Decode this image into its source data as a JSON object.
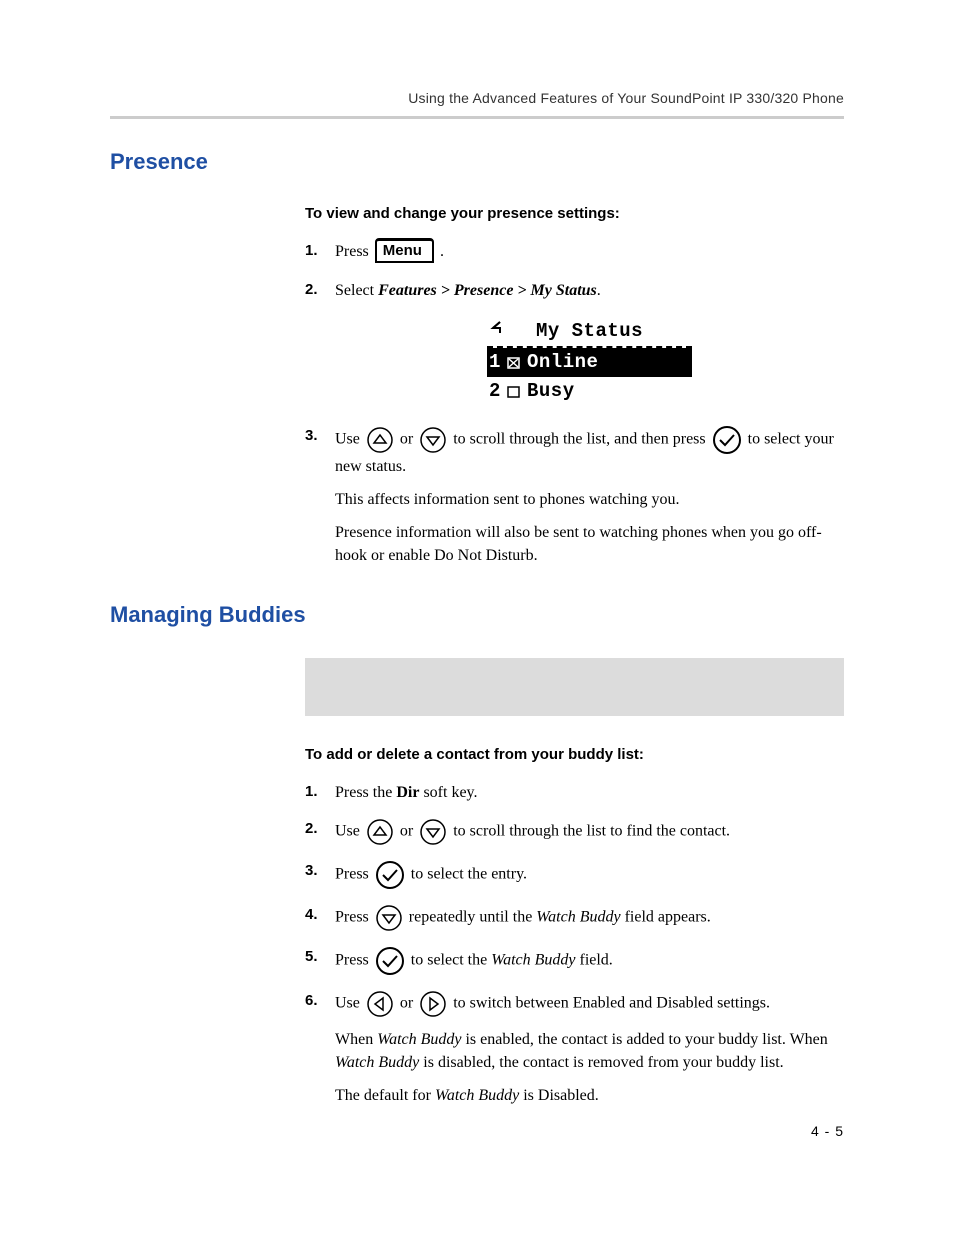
{
  "runningHead": "Using the Advanced Features of Your SoundPoint IP 330/320 Phone",
  "section1": {
    "title": "Presence",
    "lead": "To view and change your presence settings:",
    "steps": {
      "s1a": "Press ",
      "menuLabel": "Menu",
      "s1b": " .",
      "s2a": "Select ",
      "s2path": "Features > Presence > My Status",
      "s2b": ".",
      "lcd": {
        "title": "My Status",
        "r1num": "1",
        "r1label": "Online",
        "r2num": "2",
        "r2label": "Busy"
      },
      "s3a": "Use ",
      "s3b": " or ",
      "s3c": " to scroll through the list, and then press ",
      "s3d": " to select your new status.",
      "s3p2": "This affects information sent to phones watching you.",
      "s3p3": "Presence information will also be sent to watching phones when you go off-hook or enable Do Not Disturb."
    }
  },
  "section2": {
    "title": "Managing Buddies",
    "lead": "To add or delete a contact from your buddy list:",
    "steps": {
      "s1a": "Press the ",
      "s1dir": "Dir",
      "s1b": " soft key.",
      "s2a": "Use ",
      "s2b": " or ",
      "s2c": " to scroll through the list to find the contact.",
      "s3a": "Press ",
      "s3b": " to select the entry.",
      "s4a": "Press ",
      "s4b": " repeatedly until the ",
      "s4wb": "Watch Buddy",
      "s4c": " field appears.",
      "s5a": "Press ",
      "s5b": " to select the ",
      "s5wb": "Watch Buddy",
      "s5c": " field.",
      "s6a": "Use ",
      "s6b": " or ",
      "s6c": " to switch between Enabled and Disabled settings.",
      "s6p2a": "When ",
      "s6p2wb": "Watch Buddy",
      "s6p2b": " is enabled, the contact is added to your buddy list. When ",
      "s6p2wb2": "Watch Buddy",
      "s6p2c": " is disabled, the contact is removed from your buddy list.",
      "s6p3a": "The default for ",
      "s6p3wb": "Watch Buddy",
      "s6p3b": " is Disabled."
    }
  },
  "pageNumber": "4 - 5"
}
